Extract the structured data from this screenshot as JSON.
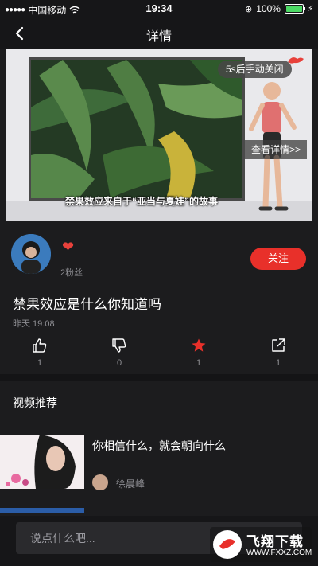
{
  "status_bar": {
    "carrier": "中国移动",
    "time": "19:34",
    "battery": "100%",
    "battery_level": 1.0
  },
  "nav": {
    "title": "详情"
  },
  "video": {
    "close_label": "5s后手动关闭",
    "detail_label": "查看详情>>",
    "subtitle": "禁果效应来自于“亚当与夏娃”的故事"
  },
  "author": {
    "fans": "2粉丝",
    "follow_label": "关注"
  },
  "post": {
    "title": "禁果效应是什么你知道吗",
    "time": "昨天 19:08"
  },
  "actions": {
    "like_count": "1",
    "dislike_count": "0",
    "favorite_count": "1",
    "share_count": "1"
  },
  "colors": {
    "accent": "#e8302a",
    "background": "#1c1c1e"
  },
  "recommend": {
    "title": "视频推荐",
    "items": [
      {
        "title": "你相信什么，就会朝向什么",
        "author": "徐晨峰"
      }
    ]
  },
  "comment": {
    "placeholder": "说点什么吧..."
  },
  "watermark": {
    "text": "飞翔下载",
    "url": "WWW.FXXZ.COM"
  }
}
